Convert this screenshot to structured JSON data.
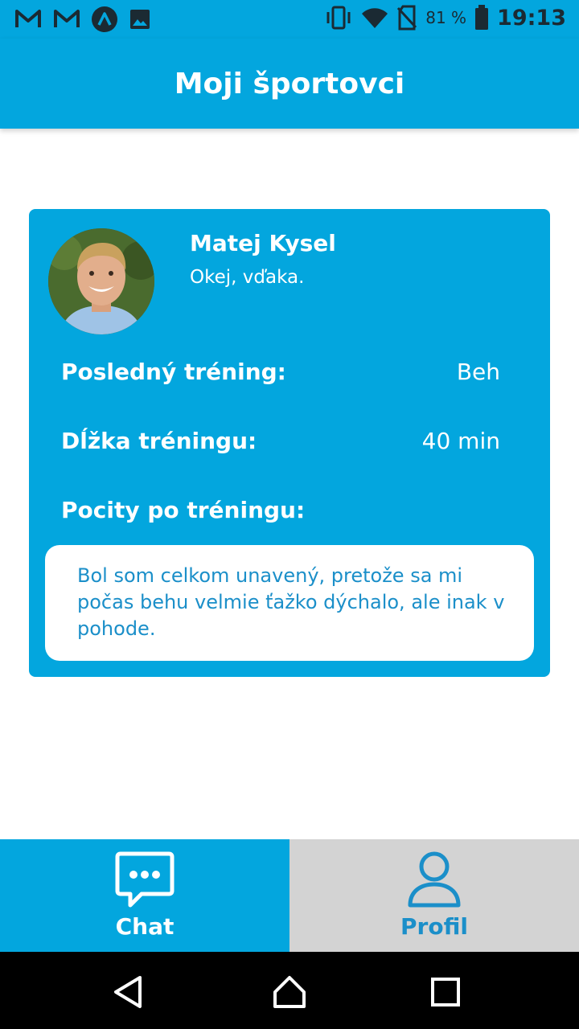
{
  "status_bar": {
    "battery_text": "81 %",
    "time": "19:13",
    "icons": [
      "gmail-icon",
      "gmail-icon",
      "arc-icon",
      "image-icon",
      "vibrate-icon",
      "wifi-icon",
      "no-sim-icon",
      "battery-icon"
    ]
  },
  "app_bar": {
    "title": "Moji športovci"
  },
  "athlete_card": {
    "name": "Matej Kysel",
    "last_message": "Okej, vďaka.",
    "last_training_label": "Posledný tréning:",
    "last_training_value": "Beh",
    "duration_label": "Dĺžka tréningu:",
    "duration_value": "40 min",
    "feelings_label": "Pocity po tréningu:",
    "feelings_text": "Bol som celkom unavený, pretože sa mi počas behu velmie ťažko dýchalo, ale inak v pohode."
  },
  "bottom_nav": {
    "tabs": [
      {
        "label": "Chat",
        "icon": "chat-bubble-icon",
        "selected": true
      },
      {
        "label": "Profil",
        "icon": "person-icon",
        "selected": false
      }
    ]
  },
  "system_nav": {
    "buttons": [
      "back-icon",
      "home-icon",
      "recents-icon"
    ]
  },
  "colors": {
    "primary": "#03A6DE",
    "accent_text": "#1B8FC9",
    "inactive_tab": "#D3D3D3"
  }
}
